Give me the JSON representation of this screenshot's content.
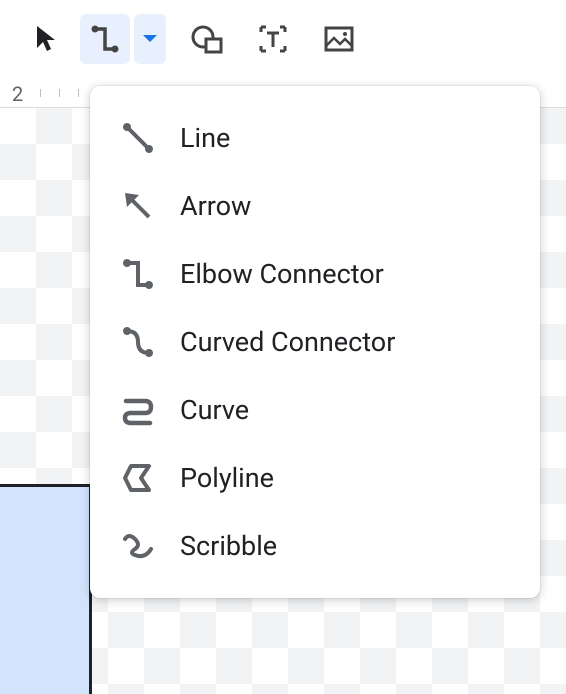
{
  "ruler": {
    "label": "2"
  },
  "menu": {
    "items": [
      {
        "label": "Line"
      },
      {
        "label": "Arrow"
      },
      {
        "label": "Elbow Connector"
      },
      {
        "label": "Curved Connector"
      },
      {
        "label": "Curve"
      },
      {
        "label": "Polyline"
      },
      {
        "label": "Scribble"
      }
    ]
  }
}
